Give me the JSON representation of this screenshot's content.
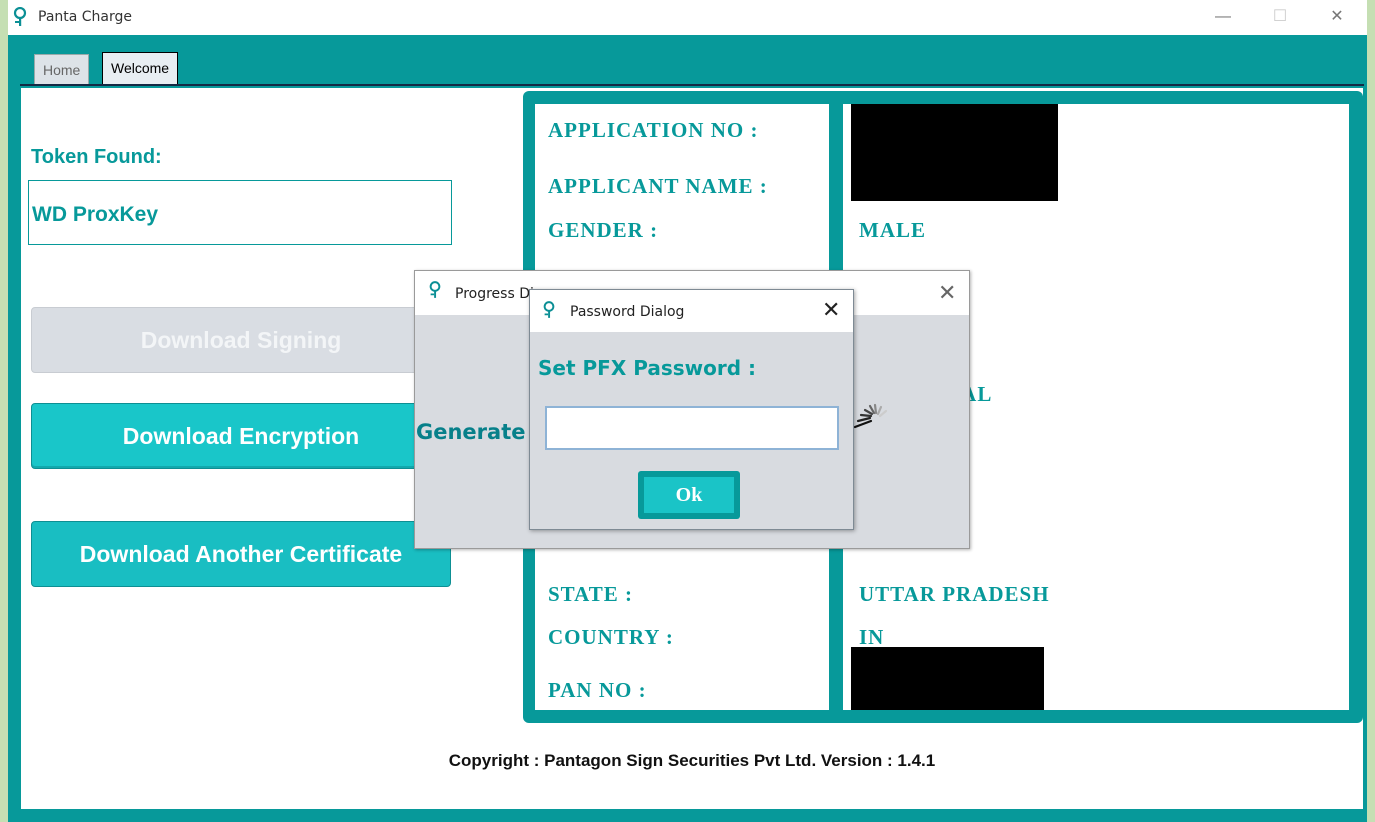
{
  "window": {
    "title": "Panta Charge",
    "minimize": "—",
    "maximize": "☐",
    "close": "✕"
  },
  "tabs": [
    {
      "label": "Home"
    },
    {
      "label": "Welcome"
    }
  ],
  "token": {
    "label": "Token Found:",
    "value": "WD ProxKey"
  },
  "buttons": {
    "download_signing": "Download Signing",
    "download_encryption": "Download Encryption",
    "download_another": "Download Another Certificate"
  },
  "info": {
    "application_no_label": "APPLICATION NO :",
    "applicant_name_label": "APPLICANT NAME :",
    "gender_label": "GENDER :",
    "gender_value": "MALE",
    "partial_value": "UAL",
    "state_label": "STATE :",
    "state_value": "UTTAR PRADESH",
    "country_label": "COUNTRY :",
    "country_value": "IN",
    "pan_label": "PAN NO :"
  },
  "footer": "Copyright : Pantagon Sign Securities Pvt Ltd.  Version : 1.4.1",
  "progress_dialog": {
    "title": "Progress Di",
    "close": "✕",
    "text": "Generate"
  },
  "password_dialog": {
    "title": "Password Dialog",
    "close": "✕",
    "label": "Set PFX Password :",
    "input_value": "",
    "ok_label": "Ok"
  },
  "colors": {
    "teal": "#07999a",
    "button_teal": "#19c6c9",
    "background": "#c5dfb3"
  },
  "icons": {
    "app": "panta-key-icon",
    "spinner": "loading-spinner-icon"
  }
}
